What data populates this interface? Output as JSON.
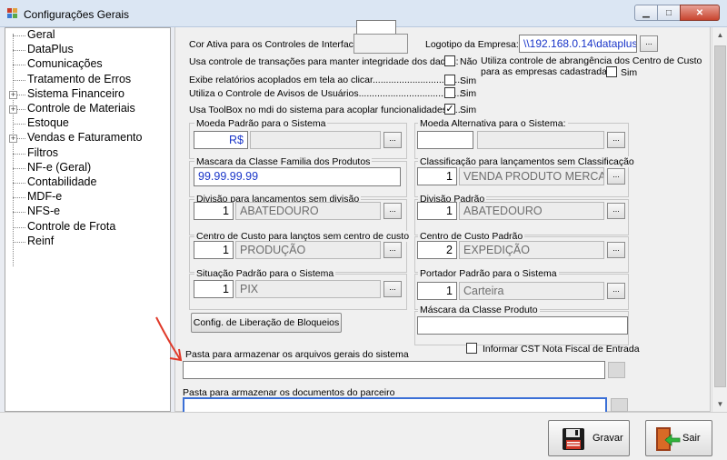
{
  "window": {
    "title": "Configurações Gerais",
    "min_glyph": "▁",
    "max_glyph": "□",
    "close_glyph": "✕"
  },
  "tree": {
    "items": [
      {
        "label": "Geral",
        "expandable": false
      },
      {
        "label": "DataPlus",
        "expandable": false
      },
      {
        "label": "Comunicações",
        "expandable": false
      },
      {
        "label": "Tratamento de Erros",
        "expandable": false
      },
      {
        "label": "Sistema Financeiro",
        "expandable": true
      },
      {
        "label": "Controle de Materiais",
        "expandable": true
      },
      {
        "label": "Estoque",
        "expandable": false
      },
      {
        "label": "Vendas e Faturamento",
        "expandable": true
      },
      {
        "label": "Filtros",
        "expandable": false
      },
      {
        "label": "NF-e (Geral)",
        "expandable": false
      },
      {
        "label": "Contabilidade",
        "expandable": false
      },
      {
        "label": "MDF-e",
        "expandable": false
      },
      {
        "label": "NFS-e",
        "expandable": false
      },
      {
        "label": "Controle de Frota",
        "expandable": false
      },
      {
        "label": "Reinf",
        "expandable": false
      }
    ]
  },
  "form": {
    "cor_ativa_label": "Cor Ativa para os Controles de Interface",
    "logotipo_label": "Logotipo da Empresa:",
    "logotipo_value": "\\\\192.168.0.14\\dataplus\\",
    "transacoes_label": "Usa controle de transações para manter integridade dos dados:",
    "transacoes_option": "Não",
    "abrangencia_label_1": "Utiliza controle de abrangência dos Centro de Custo",
    "abrangencia_label_2": "para as empresas cadastradas:",
    "abrangencia_option": "Sim",
    "relatorios_label": "Exibe relatórios acoplados em tela ao clicar.................................:",
    "relatorios_option": "Sim",
    "avisos_label": "Utiliza o Controle de Avisos de Usuários.......................................:",
    "avisos_option": "Sim",
    "toolbox_label": "Usa ToolBox no mdi do sistema para acoplar funcionalidades........",
    "toolbox_option": "Sim",
    "moeda_padrao_label": "Moeda Padrão para o Sistema",
    "moeda_padrao_value": "R$",
    "moeda_alt_label": "Moeda Alternativa para o Sistema:",
    "mascara_familia_label": "Mascara da Classe Familia dos Produtos",
    "mascara_familia_value": "99.99.99.99",
    "classificacao_label": "Classificação para lançamentos sem Classificação",
    "classificacao_code": "1",
    "classificacao_desc": "VENDA PRODUTO MERCADORIA",
    "divisao_sem_label": "Divisão para lançamentos sem divisão",
    "divisao_sem_code": "1",
    "divisao_sem_desc": "ABATEDOURO",
    "divisao_padrao_label": "Divisão Padrão",
    "divisao_padrao_code": "1",
    "divisao_padrao_desc": "ABATEDOURO",
    "cc_sem_label": "Centro de Custo para lançtos sem centro de custo",
    "cc_sem_code": "1",
    "cc_sem_desc": "PRODUÇÃO",
    "cc_padrao_label": "Centro de Custo Padrão",
    "cc_padrao_code": "2",
    "cc_padrao_desc": "EXPEDIÇÃO",
    "situacao_label": "Situação Padrão para o Sistema",
    "situacao_code": "1",
    "situacao_desc": "PIX",
    "portador_label": "Portador Padrão para o Sistema",
    "portador_code": "1",
    "portador_desc": "Carteira",
    "mascara_classe_label": "Máscara da Classe Produto",
    "bloqueios_button": "Config. de Liberação de Bloqueios",
    "cst_label": "Informar CST Nota Fiscal de Entrada",
    "pasta_gerais_label": "Pasta para armazenar os arquivos gerais do sistema",
    "pasta_parceiro_label": "Pasta para armazenar os documentos do parceiro",
    "ellipsis": "...",
    "check_mark": "✓"
  },
  "footer": {
    "gravar_label": "Gravar",
    "sair_label": "Sair"
  },
  "colors": {
    "accent": "#3a6fd6",
    "link": "#1a36c9",
    "annotation_arrow": "#e03a2a"
  }
}
